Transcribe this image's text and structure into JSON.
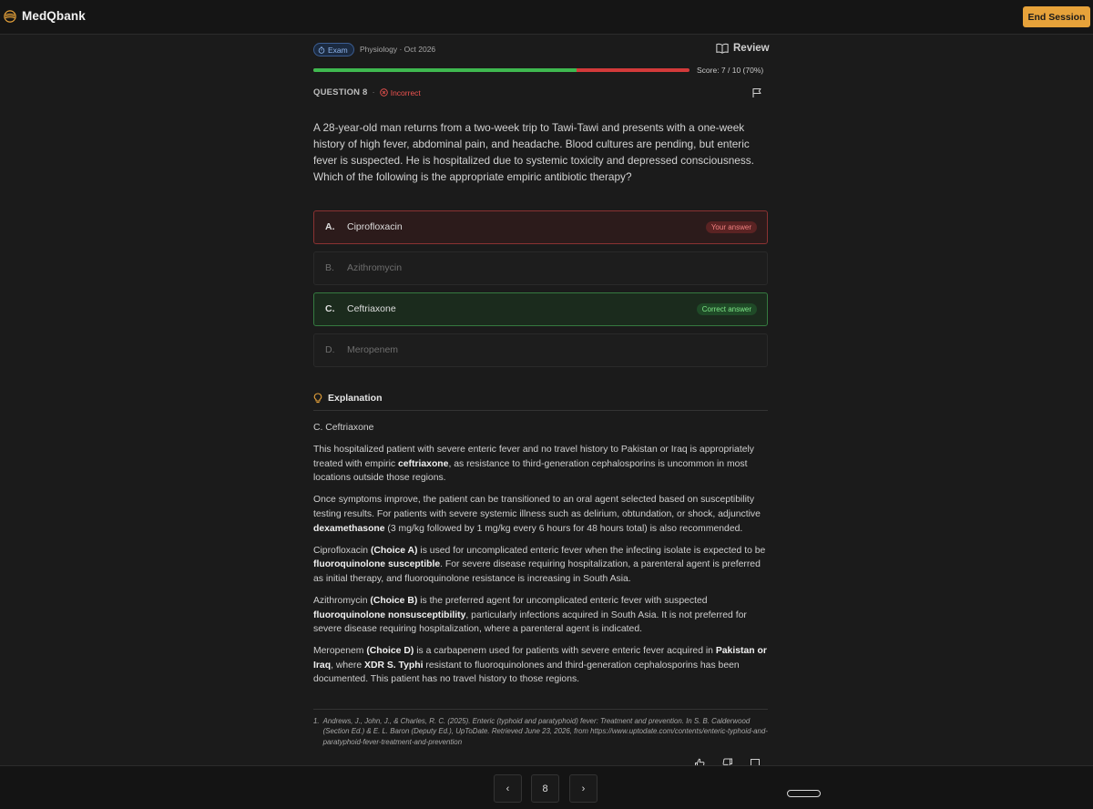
{
  "app": {
    "name": "MedQbank",
    "end_session_label": "End Session"
  },
  "session": {
    "badge": "Exam",
    "meta": "Physiology · Oct 2026",
    "review_label": "Review",
    "score_text": "Score: 7 / 10 (70%)",
    "progress_correct_fraction": 0.7
  },
  "question": {
    "label": "QUESTION 8",
    "status": "Incorrect",
    "stem": "A 28-year-old man returns from a two-week trip to Tawi-Tawi and presents with a one-week history of high fever, abdominal pain, and headache. Blood cultures are pending, but enteric fever is suspected. He is hospitalized due to systemic toxicity and depressed consciousness. Which of the following is the appropriate empiric antibiotic therapy?",
    "options": [
      {
        "letter": "A.",
        "text": "Ciprofloxacin",
        "tag": "Your answer"
      },
      {
        "letter": "B.",
        "text": "Azithromycin"
      },
      {
        "letter": "C.",
        "text": "Ceftriaxone",
        "tag": "Correct answer"
      },
      {
        "letter": "D.",
        "text": "Meropenem"
      }
    ]
  },
  "explanation": {
    "heading": "Explanation",
    "answer_line": "C. Ceftriaxone",
    "p1": {
      "a": "This hospitalized patient with severe enteric fever and no travel history to Pakistan or Iraq is appropriately treated with empiric ",
      "b": "ceftriaxone",
      "c": ", as resistance to third-generation cephalosporins is uncommon in most locations outside those regions."
    },
    "p2": {
      "a": "Once symptoms improve, the patient can be transitioned to an oral agent selected based on susceptibility testing results. For patients with severe systemic illness such as delirium, obtundation, or shock, adjunctive ",
      "b": "dexamethasone",
      "c": " (3 mg/kg followed by 1 mg/kg every 6 hours for 48 hours total) is also recommended."
    },
    "p3": {
      "a": "Ciprofloxacin ",
      "b": "(Choice A)",
      "c": " is used for uncomplicated enteric fever when the infecting isolate is expected to be ",
      "d": "fluoroquinolone susceptible",
      "e": ". For severe disease requiring hospitalization, a parenteral agent is preferred as initial therapy, and fluoroquinolone resistance is increasing in South Asia."
    },
    "p4": {
      "a": "Azithromycin ",
      "b": "(Choice B)",
      "c": " is the preferred agent for uncomplicated enteric fever with suspected ",
      "d": "fluoroquinolone nonsusceptibility",
      "e": ", particularly infections acquired in South Asia. It is not preferred for severe disease requiring hospitalization, where a parenteral agent is indicated."
    },
    "p5": {
      "a": "Meropenem ",
      "b": "(Choice D)",
      "c": " is a carbapenem used for patients with severe enteric fever acquired in ",
      "d": "Pakistan or Iraq",
      "e": ", where ",
      "f": "XDR S. Typhi",
      "g": " resistant to fluoroquinolones and third-generation cephalosporins has been documented. This patient has no travel history to those regions."
    }
  },
  "reference": {
    "number": "1.",
    "text": "Andrews, J., John, J., & Charles, R. C. (2025). Enteric (typhoid and paratyphoid) fever: Treatment and prevention. In S. B. Calderwood (Section Ed.) & E. L. Baron (Deputy Ed.), UpToDate. Retrieved June 23, 2026, from https://www.uptodate.com/contents/enteric-typhoid-and-paratyphoid-fever-treatment-and-prevention"
  },
  "pager": {
    "current": "8",
    "prev_icon": "‹",
    "next_icon": "›"
  },
  "colors": {
    "accent": "#e6a23a",
    "correct": "#3fb950",
    "incorrect": "#d33a3a"
  }
}
